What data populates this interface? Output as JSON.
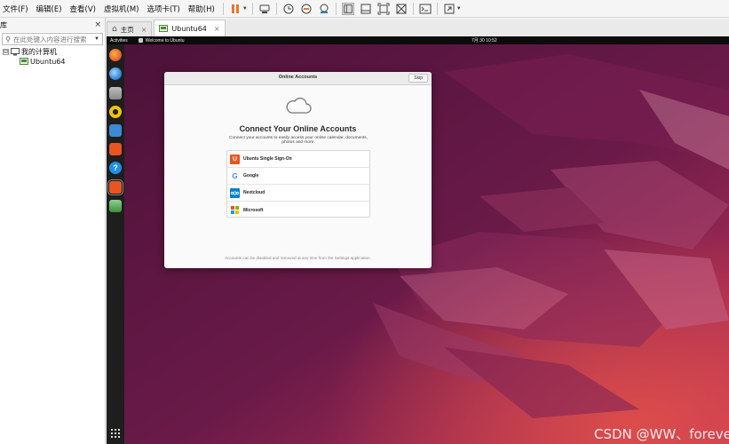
{
  "menubar": {
    "items": [
      "文件(F)",
      "编辑(E)",
      "查看(V)",
      "虚拟机(M)",
      "选项卡(T)",
      "帮助(H)"
    ],
    "toolbar_icons": [
      "pause-icon",
      "send-keys-icon",
      "snapshot-icon",
      "revert-snapshot-icon",
      "snapshot-manager-icon",
      "library-view-icon",
      "thumbnail-view-icon",
      "fit-guest-icon",
      "unity-icon",
      "console-view-icon",
      "fullscreen-icon"
    ]
  },
  "library": {
    "title": "库",
    "close": "×",
    "search_placeholder": "在此处键入内容进行搜索",
    "tree": {
      "root_toggle": "⊟",
      "root_label": "我的计算机",
      "child_label": "Ubuntu64"
    }
  },
  "tabs": [
    {
      "label": "主页",
      "icon": "home-icon"
    },
    {
      "label": "Ubuntu64",
      "icon": "vm-icon"
    }
  ],
  "tab_close": "×",
  "ubuntu": {
    "topbar": {
      "activities": "Activities",
      "window": "Welcome to Ubuntu",
      "clock": "7月 30  10:52"
    },
    "dock_apps": [
      {
        "name": "firefox",
        "color": "#e8662b"
      },
      {
        "name": "thunderbird",
        "color": "#2a7fd4"
      },
      {
        "name": "files",
        "color": "#9a9a9a"
      },
      {
        "name": "rhythmbox",
        "color": "#f5c400"
      },
      {
        "name": "libreoffice-writer",
        "color": "#3f88d6"
      },
      {
        "name": "software",
        "color": "#e95420"
      },
      {
        "name": "help",
        "color": "#1f8fe6"
      },
      {
        "name": "settings-running",
        "color": "#e95420"
      },
      {
        "name": "trash",
        "color": "#5aa55a"
      }
    ]
  },
  "dialog": {
    "title": "Online Accounts",
    "skip": "Skip",
    "headline": "Connect Your Online Accounts",
    "subtext": "Connect your accounts to easily access your online calendar, documents, photos and more.",
    "accounts": [
      {
        "label": "Ubuntu Single Sign-On",
        "icon": "ubuntu-sso-icon"
      },
      {
        "label": "Google",
        "icon": "google-icon"
      },
      {
        "label": "Nextcloud",
        "icon": "nextcloud-icon"
      },
      {
        "label": "Microsoft",
        "icon": "microsoft-icon"
      }
    ],
    "footnote": "Accounts can be disabled and removed at any time from the Settings application."
  },
  "watermark": "CSDN @WW、forever",
  "colors": {
    "ubuntu_orange": "#e95420",
    "wallpaper_dark": "#4a1238",
    "wallpaper_light": "#c4345a"
  }
}
